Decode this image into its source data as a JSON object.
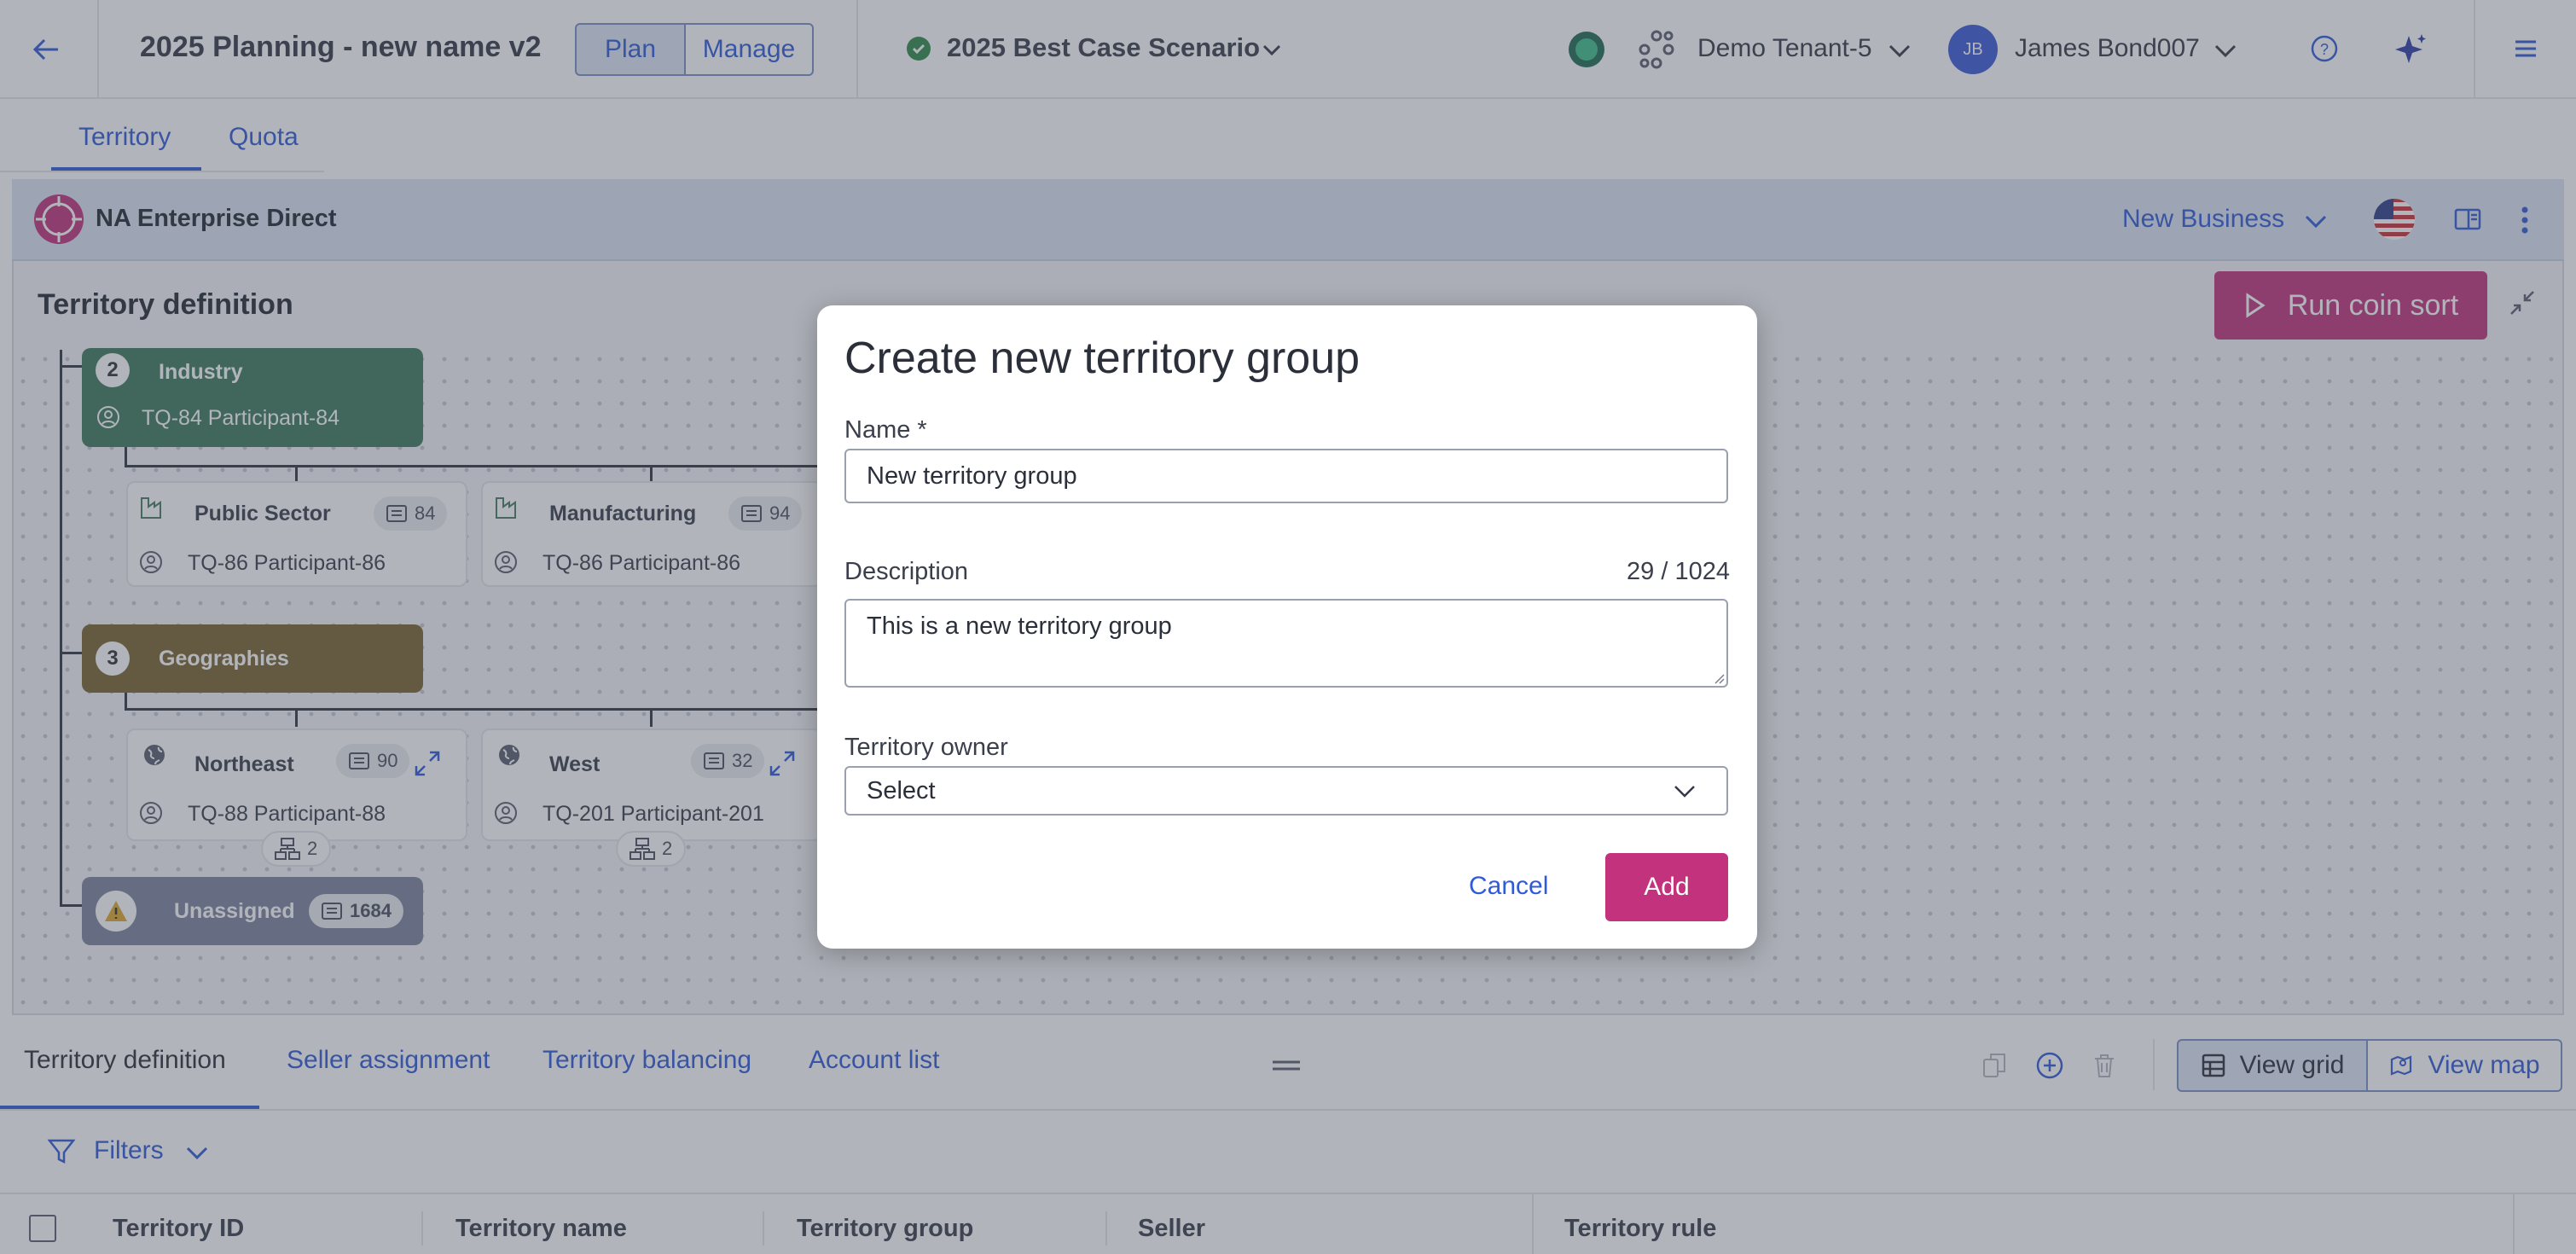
{
  "header": {
    "title": "2025 Planning - new name v2",
    "mode_plan": "Plan",
    "mode_manage": "Manage",
    "scenario": "2025 Best Case Scenario",
    "tenant": "Demo Tenant-5",
    "user_initials": "JB",
    "user_name": "James Bond007"
  },
  "tabs": {
    "territory": "Territory",
    "quota": "Quota"
  },
  "plan": {
    "name": "NA Enterprise Direct",
    "business_type": "New Business",
    "section_title": "Territory definition",
    "run_button": "Run coin sort"
  },
  "tree": {
    "industry": {
      "number": "2",
      "name": "Industry",
      "owner": "TQ-84 Participant-84"
    },
    "public_sector": {
      "name": "Public Sector",
      "count": "84",
      "owner": "TQ-86 Participant-86"
    },
    "manufacturing": {
      "name": "Manufacturing",
      "count": "94",
      "owner": "TQ-86 Participant-86"
    },
    "geographies": {
      "number": "3",
      "name": "Geographies"
    },
    "northeast": {
      "name": "Northeast",
      "count": "90",
      "owner": "TQ-88 Participant-88",
      "children": "2"
    },
    "west": {
      "name": "West",
      "count": "32",
      "owner": "TQ-201 Participant-201",
      "children": "2"
    },
    "unassigned": {
      "name": "Unassigned",
      "count": "1684"
    }
  },
  "modal": {
    "title": "Create new territory group",
    "name_label": "Name *",
    "name_value": "New territory group",
    "description_label": "Description",
    "description_counter": "29 / 1024",
    "description_value": "This is a new territory group",
    "owner_label": "Territory owner",
    "owner_placeholder": "Select",
    "cancel": "Cancel",
    "add": "Add"
  },
  "bottom_tabs": {
    "definition": "Territory definition",
    "seller": "Seller assignment",
    "balancing": "Territory balancing",
    "accounts": "Account list"
  },
  "view": {
    "grid": "View grid",
    "map": "View map"
  },
  "filters": "Filters",
  "table": {
    "columns": [
      "Territory ID",
      "Territory name",
      "Territory group",
      "Seller",
      "Territory rule"
    ]
  },
  "colors": {
    "accent": "#c2327d",
    "link": "#2f5bd8",
    "industry": "#3e7a5e",
    "geographies": "#7a6430",
    "unassigned": "#7e86a0"
  }
}
